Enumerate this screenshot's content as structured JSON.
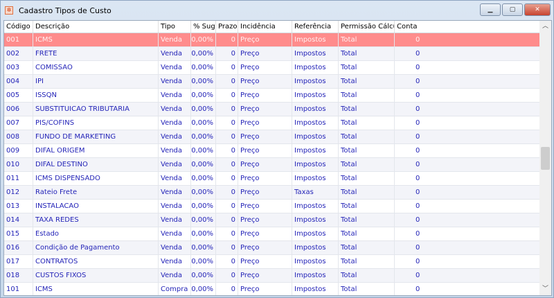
{
  "window": {
    "title": "Cadastro Tipos de Custo",
    "icon": "app-logo-icon",
    "controls": [
      "minimize",
      "maximize",
      "close"
    ]
  },
  "columns": [
    "Código",
    "Descrição",
    "Tipo",
    "% Sug.",
    "Prazo",
    "Incidência",
    "Referência",
    "Permissão Cálculo",
    "Conta"
  ],
  "rows": [
    [
      "001",
      "ICMS",
      "Venda",
      "0,00%",
      "0",
      "Preço",
      "Impostos",
      "Total",
      "0"
    ],
    [
      "002",
      "FRETE",
      "Venda",
      "0,00%",
      "0",
      "Preço",
      "Impostos",
      "Total",
      "0"
    ],
    [
      "003",
      "COMISSAO",
      "Venda",
      "0,00%",
      "0",
      "Preço",
      "Impostos",
      "Total",
      "0"
    ],
    [
      "004",
      "IPI",
      "Venda",
      "0,00%",
      "0",
      "Preço",
      "Impostos",
      "Total",
      "0"
    ],
    [
      "005",
      "ISSQN",
      "Venda",
      "0,00%",
      "0",
      "Preço",
      "Impostos",
      "Total",
      "0"
    ],
    [
      "006",
      "SUBSTITUICAO TRIBUTARIA",
      "Venda",
      "0,00%",
      "0",
      "Preço",
      "Impostos",
      "Total",
      "0"
    ],
    [
      "007",
      "PIS/COFINS",
      "Venda",
      "0,00%",
      "0",
      "Preço",
      "Impostos",
      "Total",
      "0"
    ],
    [
      "008",
      "FUNDO DE MARKETING",
      "Venda",
      "0,00%",
      "0",
      "Preço",
      "Impostos",
      "Total",
      "0"
    ],
    [
      "009",
      "DIFAL ORIGEM",
      "Venda",
      "0,00%",
      "0",
      "Preço",
      "Impostos",
      "Total",
      "0"
    ],
    [
      "010",
      "DIFAL DESTINO",
      "Venda",
      "0,00%",
      "0",
      "Preço",
      "Impostos",
      "Total",
      "0"
    ],
    [
      "011",
      "ICMS DISPENSADO",
      "Venda",
      "0,00%",
      "0",
      "Preço",
      "Impostos",
      "Total",
      "0"
    ],
    [
      "012",
      "Rateio Frete",
      "Venda",
      "0,00%",
      "0",
      "Preço",
      "Taxas",
      "Total",
      "0"
    ],
    [
      "013",
      "INSTALACAO",
      "Venda",
      "0,00%",
      "0",
      "Preço",
      "Impostos",
      "Total",
      "0"
    ],
    [
      "014",
      "TAXA REDES",
      "Venda",
      "0,00%",
      "0",
      "Preço",
      "Impostos",
      "Total",
      "0"
    ],
    [
      "015",
      "Estado",
      "Venda",
      "0,00%",
      "0",
      "Preço",
      "Impostos",
      "Total",
      "0"
    ],
    [
      "016",
      "Condição de Pagamento",
      "Venda",
      "0,00%",
      "0",
      "Preço",
      "Impostos",
      "Total",
      "0"
    ],
    [
      "017",
      "CONTRATOS",
      "Venda",
      "0,00%",
      "0",
      "Preço",
      "Impostos",
      "Total",
      "0"
    ],
    [
      "018",
      "CUSTOS FIXOS",
      "Venda",
      "0,00%",
      "0",
      "Preço",
      "Impostos",
      "Total",
      "0"
    ],
    [
      "101",
      "ICMS",
      "Compra",
      "0,00%",
      "0",
      "Preço",
      "Impostos",
      "Total",
      "0"
    ]
  ],
  "selected_row": 0,
  "colors": {
    "selected": "#ff8c8c",
    "text": "#2424b8"
  }
}
